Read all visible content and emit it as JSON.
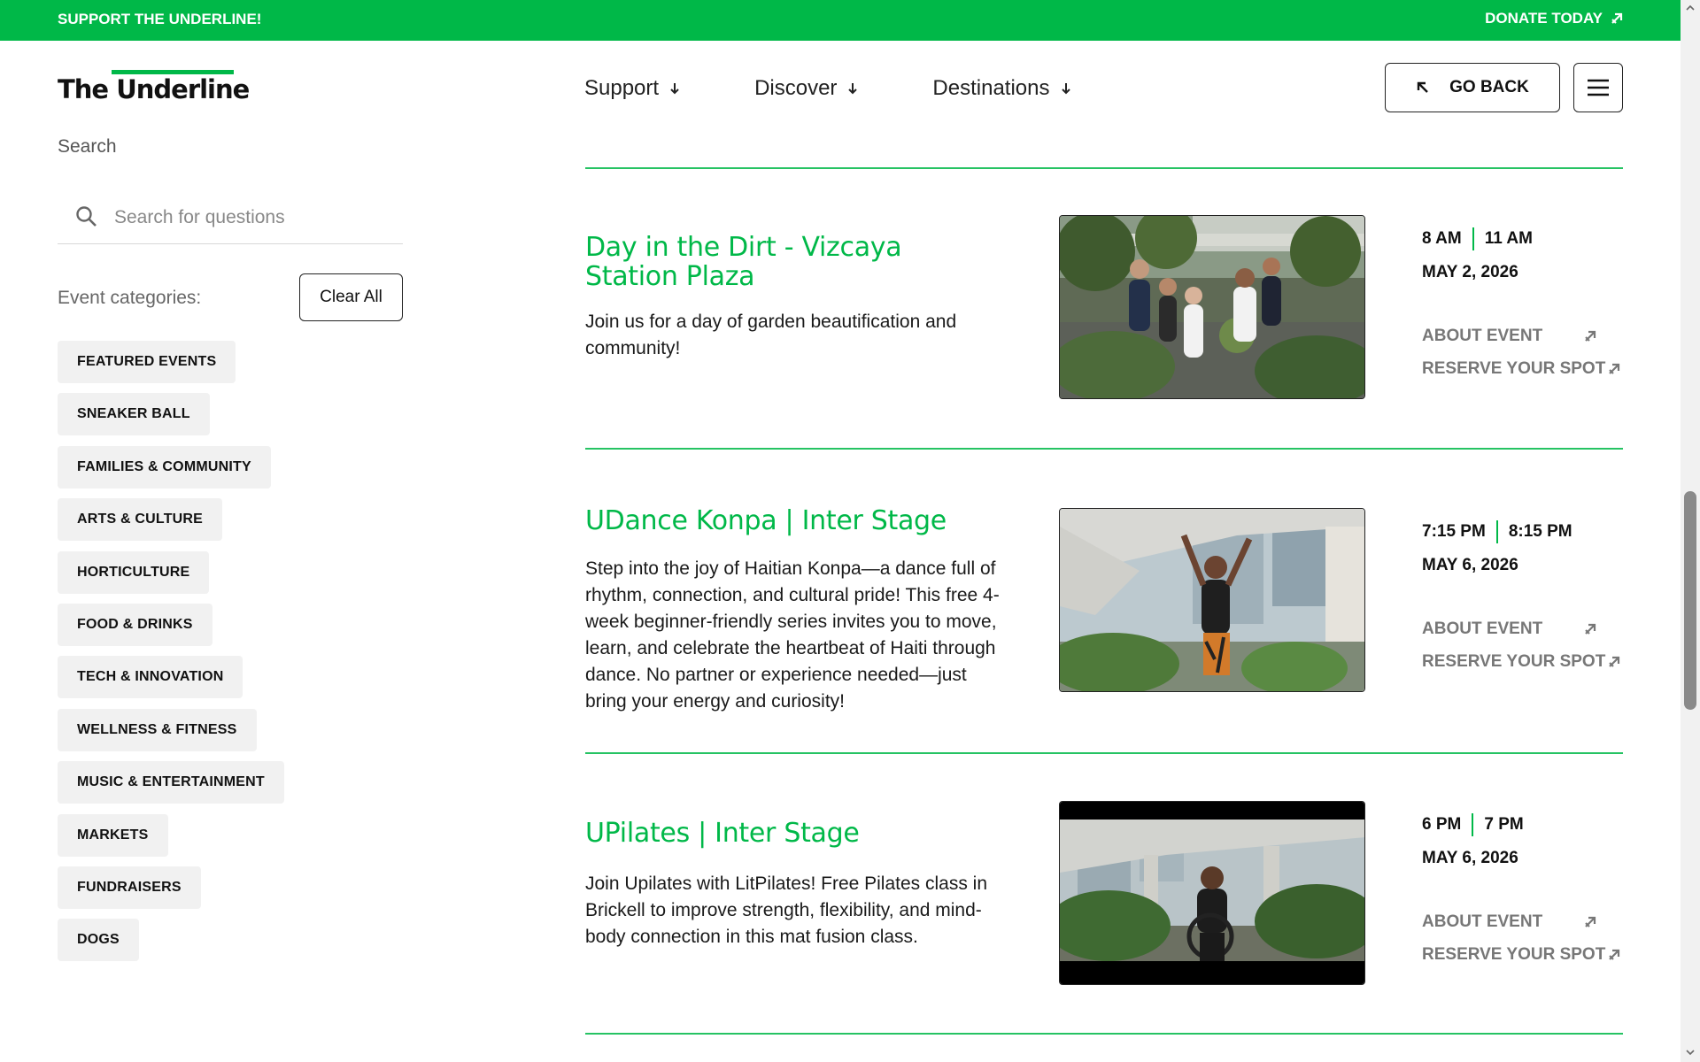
{
  "topbar": {
    "support": "SUPPORT THE UNDERLINE!",
    "donate": "DONATE TODAY"
  },
  "header": {
    "logo": "The Underline",
    "nav": [
      {
        "label": "Support"
      },
      {
        "label": "Discover"
      },
      {
        "label": "Destinations"
      }
    ],
    "go_back": "GO BACK"
  },
  "sidebar": {
    "search_label": "Search",
    "search_placeholder": "Search for questions",
    "categories_label": "Event categories:",
    "clear_all": "Clear All",
    "categories": [
      "FEATURED EVENTS",
      "SNEAKER BALL",
      "FAMILIES & COMMUNITY",
      "ARTS & CULTURE",
      "HORTICULTURE",
      "FOOD & DRINKS",
      "TECH & INNOVATION",
      "WELLNESS & FITNESS",
      "MUSIC & ENTERTAINMENT",
      "MARKETS",
      "FUNDRAISERS",
      "DOGS"
    ]
  },
  "events": [
    {
      "title": "Day in the Dirt - Vizcaya Station Plaza",
      "description": "Join us for a day of garden beautification and community!",
      "start": "8 AM",
      "end": "11 AM",
      "date": "MAY 2, 2026",
      "about": "ABOUT EVENT",
      "reserve": "RESERVE YOUR SPOT"
    },
    {
      "title": "UDance Konpa | Inter Stage",
      "description": "Step into the joy of Haitian Konpa—a dance full of rhythm, connection, and cultural pride! This free 4-week beginner-friendly series invites you to move, learn, and celebrate the heartbeat of Haiti through dance. No partner or experience needed—just bring your energy and curiosity!",
      "start": "7:15 PM",
      "end": "8:15 PM",
      "date": "MAY 6, 2026",
      "about": "ABOUT EVENT",
      "reserve": "RESERVE YOUR SPOT"
    },
    {
      "title": "UPilates | Inter Stage",
      "description": "Join Upilates with LitPilates! Free Pilates class in Brickell to improve strength, flexibility, and mind-body connection in this mat fusion class.",
      "start": "6 PM",
      "end": "7 PM",
      "date": "MAY 6, 2026",
      "about": "ABOUT EVENT",
      "reserve": "RESERVE YOUR SPOT"
    }
  ],
  "colors": {
    "brand_green": "#00b848",
    "text": "#111111",
    "muted_link": "#777777",
    "chip_bg": "#f1f1f1"
  }
}
